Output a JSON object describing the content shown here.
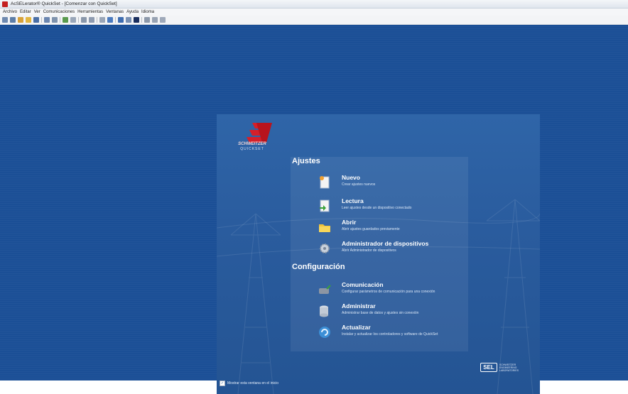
{
  "window": {
    "title": "AcSELerator® QuickSet - [Comenzar con QuickSet]"
  },
  "menu": {
    "items": [
      "Archivo",
      "Editar",
      "Ver",
      "Comunicaciones",
      "Herramientas",
      "Ventanas",
      "Ayuda",
      "Idioma"
    ]
  },
  "toolbar": {
    "buttons": [
      {
        "icon": "back-icon",
        "color": "#6f8ab0"
      },
      {
        "icon": "settings-icon",
        "color": "#5d7ea8"
      },
      {
        "icon": "new-icon",
        "color": "#d8a23a"
      },
      {
        "icon": "open-folder-icon",
        "color": "#e2b640"
      },
      {
        "icon": "save-icon",
        "color": "#4a6fa6"
      },
      {
        "icon": "save-all-icon",
        "color": "#6b86b0"
      },
      {
        "icon": "print-icon",
        "color": "#7f93ad"
      },
      {
        "icon": "read-icon",
        "color": "#5a9a4e"
      },
      {
        "icon": "send-icon",
        "color": "#9aa7b9"
      },
      {
        "icon": "cut-icon",
        "color": "#8a98ab"
      },
      {
        "icon": "copy-icon",
        "color": "#8e9bb0"
      },
      {
        "icon": "paste-icon",
        "color": "#9aa6b8"
      },
      {
        "icon": "connect-icon",
        "color": "#4c7bbf"
      },
      {
        "icon": "disconnect-icon",
        "color": "#3f6db0"
      },
      {
        "icon": "terminal-icon",
        "color": "#7a91b3"
      },
      {
        "icon": "stop-icon",
        "color": "#1b2f5e"
      },
      {
        "icon": "grid-icon",
        "color": "#8d99aa"
      },
      {
        "icon": "list-icon",
        "color": "#98a3b3"
      },
      {
        "icon": "help-icon",
        "color": "#9fa9b9"
      }
    ]
  },
  "brand": {
    "name": "SCHWEITZER",
    "product": "QUICKSET"
  },
  "sections": {
    "ajustes": {
      "heading": "Ajustes",
      "items": [
        {
          "title": "Nuevo",
          "desc": "Crear ajustes nuevos",
          "icon": "new-document-icon"
        },
        {
          "title": "Lectura",
          "desc": "Leer ajustes desde un dispositivo conectado",
          "icon": "read-settings-icon"
        },
        {
          "title": "Abrir",
          "desc": "Abrir ajustes guardados previamente",
          "icon": "folder-icon"
        },
        {
          "title": "Administrador de dispositivos",
          "desc": "Abrir Administrador de dispositivos",
          "icon": "device-manager-icon"
        }
      ]
    },
    "configuracion": {
      "heading": "Configuración",
      "items": [
        {
          "title": "Comunicación",
          "desc": "Configurar parámetros de comunicación para una conexión",
          "icon": "communication-icon"
        },
        {
          "title": "Administrar",
          "desc": "Administrar base de datos y ajustes sin conexión",
          "icon": "database-icon"
        },
        {
          "title": "Actualizar",
          "desc": "Instalar y actualizar los controladores y software de QuickSet",
          "icon": "update-icon"
        }
      ]
    }
  },
  "startup": {
    "label": "Mostrar esta ventana en el inicio",
    "checked": true
  },
  "sel": {
    "logo": "SEL",
    "tagline": "SCHWEITZER ENGINEERING LABORATORIES"
  },
  "colors": {
    "workspace": "#1b4f96",
    "panel": "#2a5c9e",
    "brand_red": "#d4202a"
  }
}
